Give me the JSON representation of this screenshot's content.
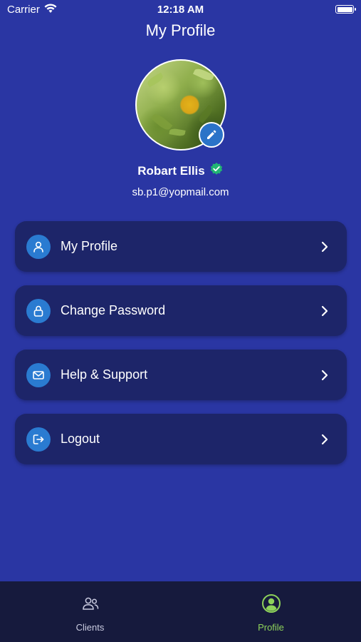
{
  "status_bar": {
    "carrier": "Carrier",
    "time": "12:18 AM"
  },
  "header": {
    "title": "My Profile"
  },
  "profile": {
    "name": "Robart Ellis",
    "email": "sb.p1@yopmail.com"
  },
  "menu": [
    {
      "label": "My Profile",
      "icon": "user-icon"
    },
    {
      "label": "Change Password",
      "icon": "lock-icon"
    },
    {
      "label": "Help & Support",
      "icon": "mail-icon"
    },
    {
      "label": "Logout",
      "icon": "logout-icon"
    }
  ],
  "tabs": [
    {
      "label": "Clients",
      "icon": "clients-icon",
      "active": false
    },
    {
      "label": "Profile",
      "icon": "profile-icon",
      "active": true
    }
  ],
  "colors": {
    "background": "#2a36a3",
    "card": "#1d2569",
    "accent": "#2a7bd1",
    "active_tab": "#8ed25a",
    "verified": "#22b573",
    "tab_bar": "#161a3d"
  }
}
